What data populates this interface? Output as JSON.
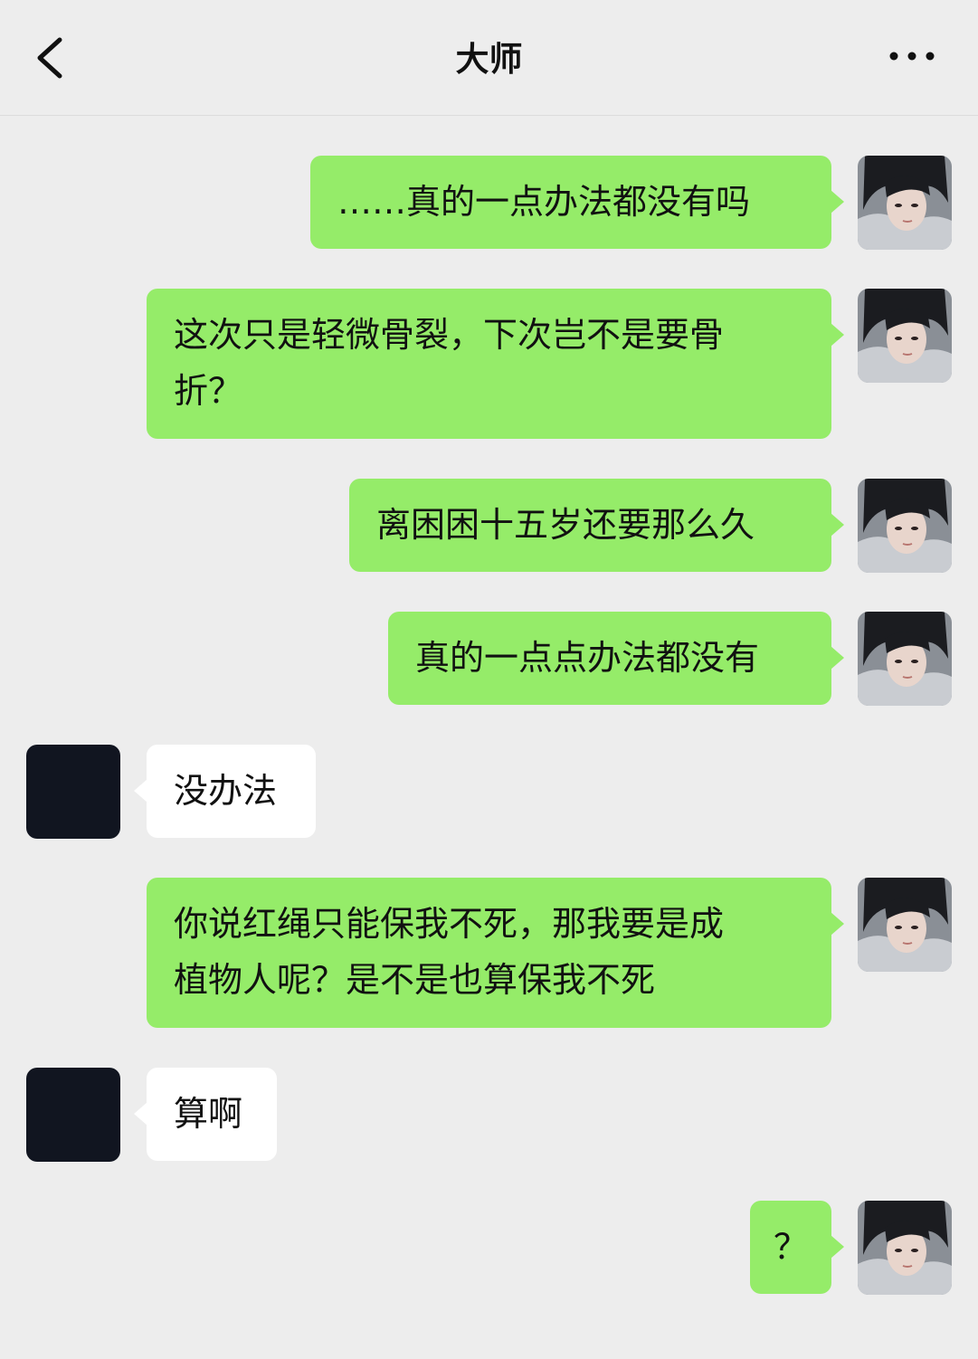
{
  "header": {
    "title": "大师",
    "back_icon": "chevron-left-icon",
    "more_icon": "ellipsis-icon"
  },
  "colors": {
    "background": "#ededed",
    "outgoing_bubble": "#95ec69",
    "incoming_bubble": "#ffffff",
    "incoming_avatar": "#111520"
  },
  "messages": [
    {
      "sender": "me",
      "text": "……真的一点办法都没有吗"
    },
    {
      "sender": "me",
      "text": "这次只是轻微骨裂，下次岂不是要骨\n折？"
    },
    {
      "sender": "me",
      "text": "离困困十五岁还要那么久"
    },
    {
      "sender": "me",
      "text": "真的一点点办法都没有"
    },
    {
      "sender": "them",
      "text": "没办法"
    },
    {
      "sender": "me",
      "text": "你说红绳只能保我不死，那我要是成\n植物人呢？是不是也算保我不死"
    },
    {
      "sender": "them",
      "text": "算啊"
    },
    {
      "sender": "me",
      "text": "？"
    }
  ]
}
